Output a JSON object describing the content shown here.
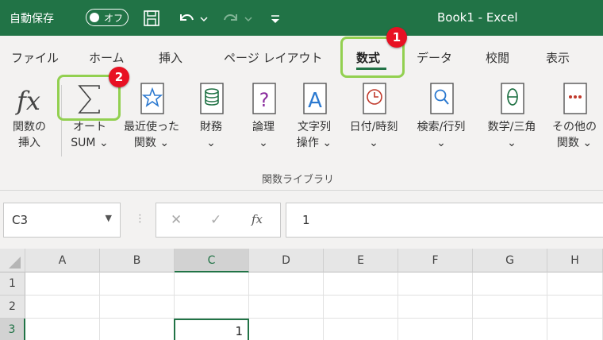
{
  "titlebar": {
    "autosave_label": "自動保存",
    "autosave_state": "オフ",
    "title": "Book1  -  Excel"
  },
  "tabs": [
    {
      "label": "ファイル"
    },
    {
      "label": "ホーム"
    },
    {
      "label": "挿入"
    },
    {
      "label": "ページ レイアウト"
    },
    {
      "label": "数式",
      "active": true
    },
    {
      "label": "データ"
    },
    {
      "label": "校閲"
    },
    {
      "label": "表示"
    }
  ],
  "annotations": {
    "badge1": "1",
    "badge2": "2"
  },
  "ribbon": {
    "group_label": "関数ライブラリ",
    "buttons": [
      {
        "line1": "関数の",
        "line2": "挿入",
        "icon": "fx-icon"
      },
      {
        "line1": "オート",
        "line2": "SUM ⌄",
        "icon": "sigma-icon"
      },
      {
        "line1": "最近使った",
        "line2": "関数 ⌄",
        "icon": "star-book-icon"
      },
      {
        "line1": "財務",
        "line2": "⌄",
        "icon": "coins-book-icon"
      },
      {
        "line1": "論理",
        "line2": "⌄",
        "icon": "question-book-icon"
      },
      {
        "line1": "文字列",
        "line2": "操作 ⌄",
        "icon": "text-book-icon"
      },
      {
        "line1": "日付/時刻",
        "line2": "⌄",
        "icon": "clock-book-icon"
      },
      {
        "line1": "検索/行列",
        "line2": "⌄",
        "icon": "search-book-icon"
      },
      {
        "line1": "数学/三角",
        "line2": "⌄",
        "icon": "theta-book-icon"
      },
      {
        "line1": "その他の",
        "line2": "関数 ⌄",
        "icon": "more-book-icon"
      }
    ]
  },
  "formula_bar": {
    "name_box": "C3",
    "fx_label": "fx",
    "value": "1"
  },
  "grid": {
    "columns": [
      "A",
      "B",
      "C",
      "D",
      "E",
      "F",
      "G",
      "H"
    ],
    "rows": [
      "1",
      "2",
      "3"
    ],
    "active_value": "1"
  },
  "colors": {
    "brand": "#217346",
    "highlight": "#92d050",
    "badge": "#e81123"
  }
}
